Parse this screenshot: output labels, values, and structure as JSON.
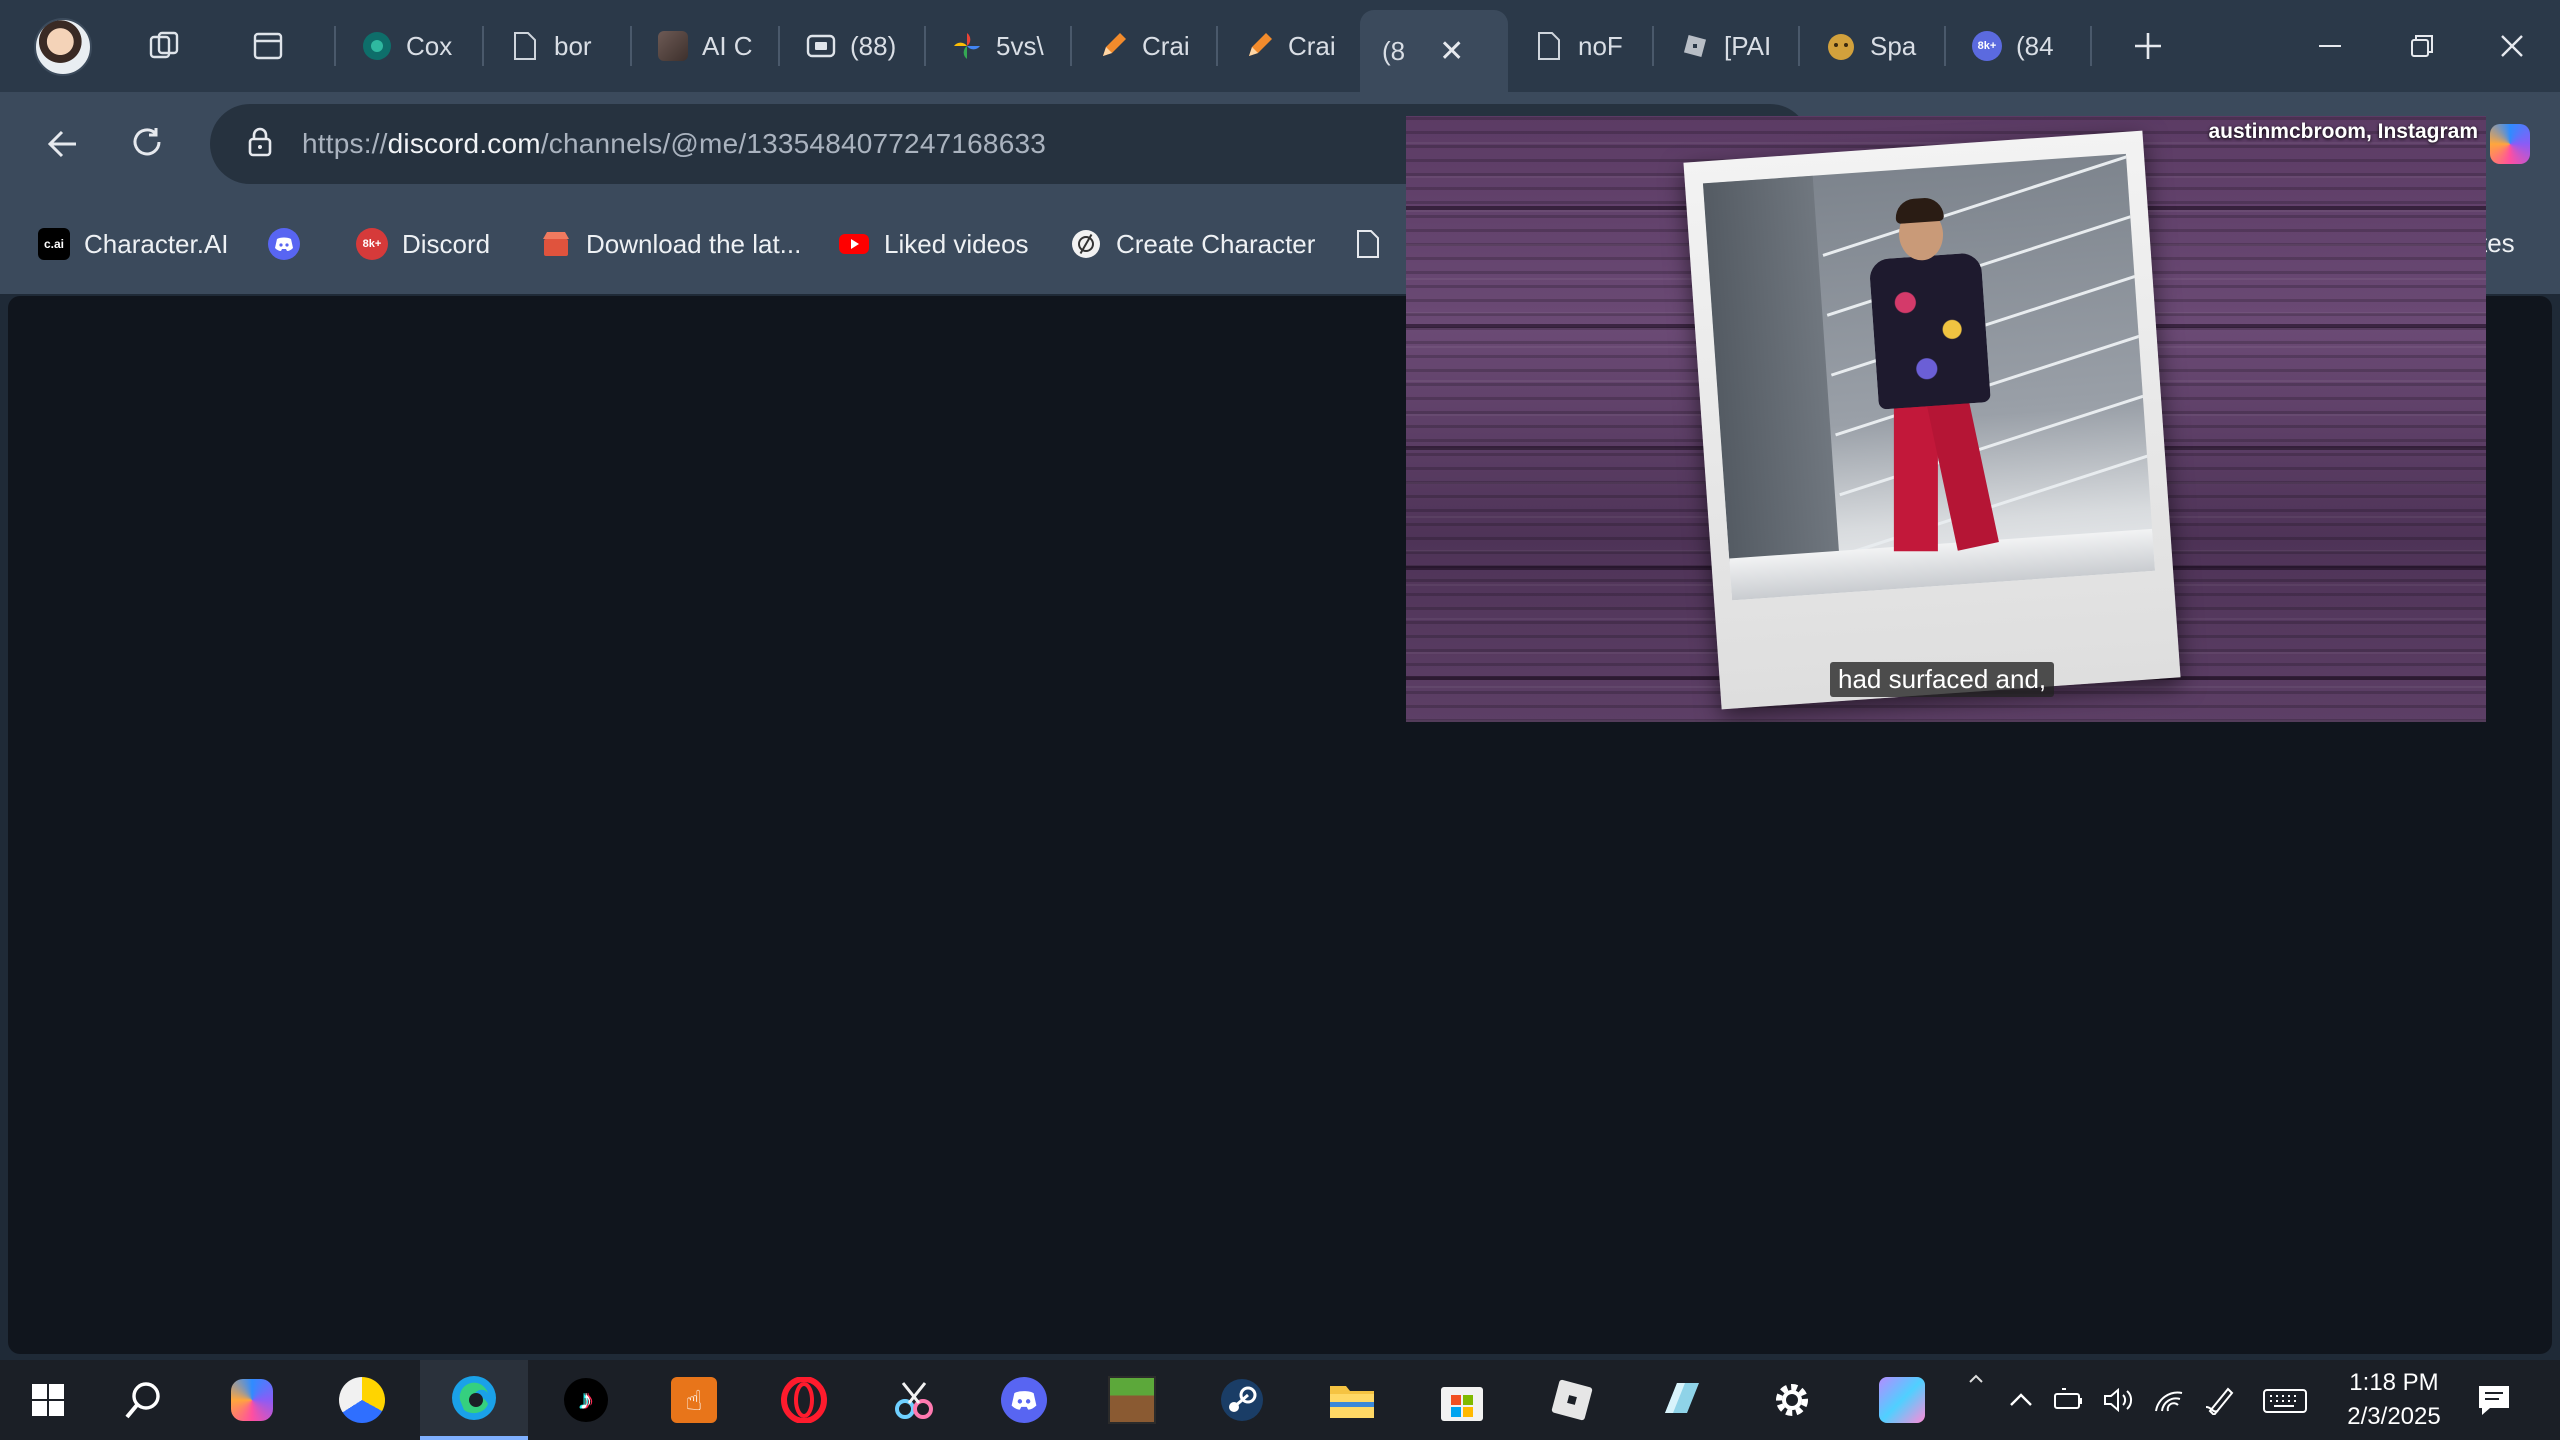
{
  "browser": {
    "tabs": [
      {
        "label": "Cox",
        "icon": "circle-teal"
      },
      {
        "label": "bor",
        "icon": "page-icon"
      },
      {
        "label": "AI C",
        "icon": "avatar-image"
      },
      {
        "label": "(88)",
        "icon": "media-icon"
      },
      {
        "label": "5vs\\",
        "icon": "pinwheel-icon"
      },
      {
        "label": "Crai",
        "icon": "pencil-icon"
      },
      {
        "label": "Crai",
        "icon": "pencil-icon"
      },
      {
        "label": "(8",
        "icon": "none",
        "active": true
      },
      {
        "label": "noF",
        "icon": "page-icon"
      },
      {
        "label": "[PAI",
        "icon": "roblox-icon"
      },
      {
        "label": "Spa",
        "icon": "face-icon"
      },
      {
        "label": "(84",
        "icon": "8k-badge"
      }
    ],
    "address": {
      "url_prefix": "https://",
      "url_domain": "discord.com",
      "url_path": "/channels/@me/1335484077247168633"
    },
    "bookmarks": [
      {
        "label": "Character.AI",
        "icon": "cai-icon",
        "badge": "c.ai"
      },
      {
        "label": "",
        "icon": "discord-icon"
      },
      {
        "label": "Discord",
        "icon": "8k-icon",
        "badge": "8k+"
      },
      {
        "label": "Download the lat...",
        "icon": "store-icon"
      },
      {
        "label": "Liked videos",
        "icon": "youtube-icon"
      },
      {
        "label": "Create Character",
        "icon": "openai-icon"
      },
      {
        "label": "",
        "icon": "page-icon"
      }
    ],
    "bookmarks_tail": "tes"
  },
  "video": {
    "credit": "austinmcbroom, Instagram",
    "caption": "had surfaced and,"
  },
  "taskbar": {
    "apps": [
      "start-icon",
      "search-icon",
      "copilot-icon",
      "chrome-like-icon",
      "edge-icon",
      "tiktok-icon",
      "touch-app-icon",
      "opera-icon",
      "snip-icon",
      "discord-icon",
      "minecraft-icon",
      "steam-icon",
      "file-explorer-icon",
      "store-icon",
      "roblox-icon",
      "paint-icon",
      "settings-icon",
      "anime-app-icon"
    ],
    "time": "1:18 PM",
    "date": "2/3/2025"
  },
  "colors": {
    "tabbar": "#2b3949",
    "toolbar": "#3b4a5c",
    "content": "#10151d",
    "taskbar": "#1b1f26"
  }
}
